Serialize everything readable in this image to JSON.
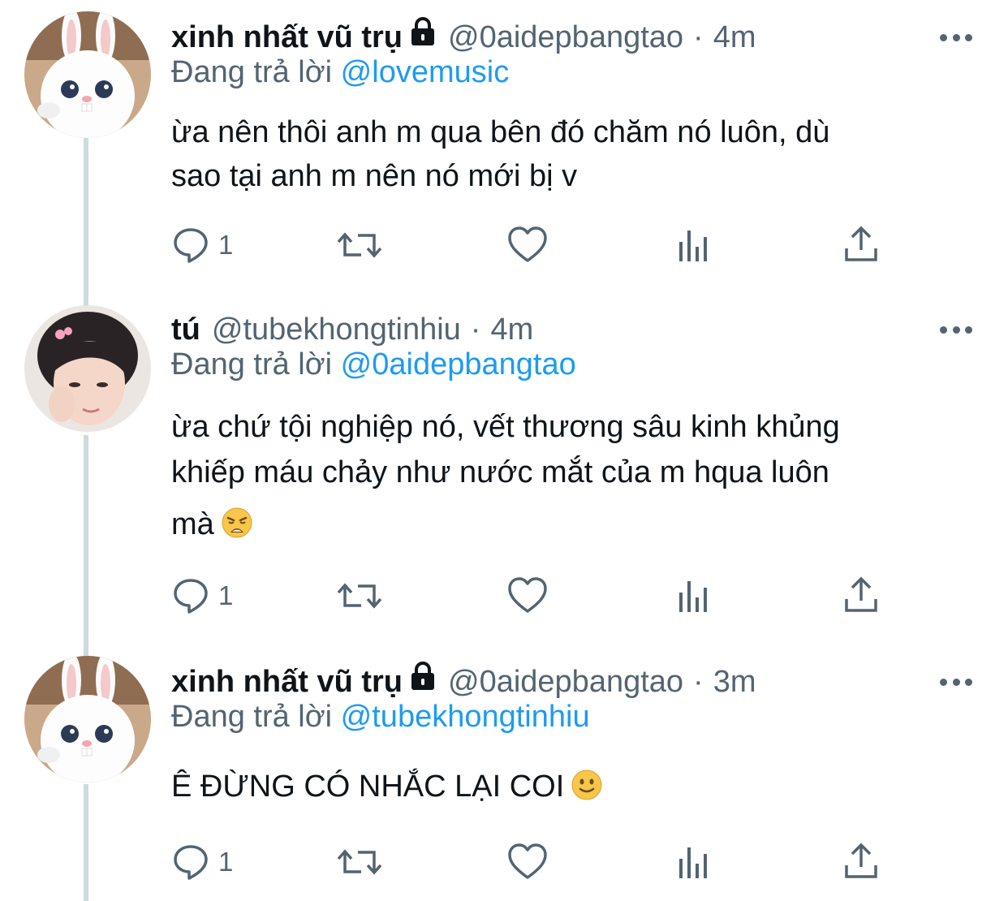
{
  "tweets": [
    {
      "name": "xinh nhất vũ trụ",
      "locked": true,
      "handle": "@0aidepbangtao",
      "time": "4m",
      "reply_prefix": "Đang trả lời",
      "reply_to": "@lovemusic",
      "text_lines": [
        "ừa nên thôi anh m qua bên đó chăm nó luôn, dù",
        "sao tại anh m nên nó mới bị v"
      ],
      "emoji": "",
      "reply_count": "1",
      "avatar": "bunny"
    },
    {
      "name": "tú",
      "locked": false,
      "handle": "@tubekhongtinhiu",
      "time": "4m",
      "reply_prefix": "Đang trả lời",
      "reply_to": "@0aidepbangtao",
      "text_lines": [
        "ừa chứ tội nghiệp nó, vết thương sâu kinh khủng",
        "khiếp máu chảy như nước mắt của m hqua luôn",
        "mà"
      ],
      "emoji": "weary-face",
      "reply_count": "1",
      "avatar": "person"
    },
    {
      "name": "xinh nhất vũ trụ",
      "locked": true,
      "handle": "@0aidepbangtao",
      "time": "3m",
      "reply_prefix": "Đang trả lời",
      "reply_to": "@tubekhongtinhiu",
      "text_lines": [
        "Ê ĐỪNG CÓ NHẮC LẠI COI"
      ],
      "emoji": "slightly-smiling-face",
      "reply_count": "1",
      "avatar": "bunny"
    }
  ],
  "colors": {
    "link": "#1d9bf0",
    "secondary": "#536471",
    "thread_line": "#cfd9de"
  },
  "icons": [
    "reply-icon",
    "retweet-icon",
    "like-icon",
    "views-icon",
    "share-icon",
    "lock-icon",
    "more-icon"
  ]
}
